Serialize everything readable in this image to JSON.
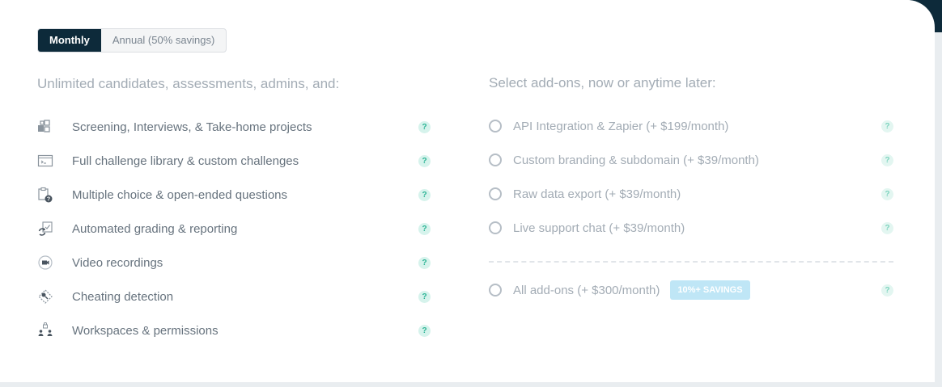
{
  "billing_toggle": {
    "options": [
      "Monthly",
      "Annual (50% savings)"
    ],
    "selected": "Monthly"
  },
  "features": {
    "heading": "Unlimited candidates, assessments, admins, and:",
    "items": [
      {
        "label": "Screening, Interviews, & Take-home projects",
        "icon": "blocks-icon",
        "help": "?"
      },
      {
        "label": "Full challenge library & custom challenges",
        "icon": "terminal-icon",
        "help": "?"
      },
      {
        "label": "Multiple choice & open-ended questions",
        "icon": "clipboard-question-icon",
        "help": "?"
      },
      {
        "label": "Automated grading & reporting",
        "icon": "refresh-check-icon",
        "help": "?"
      },
      {
        "label": "Video recordings",
        "icon": "video-camera-icon",
        "help": "?"
      },
      {
        "label": "Cheating detection",
        "icon": "detection-icon",
        "help": "?"
      },
      {
        "label": "Workspaces & permissions",
        "icon": "users-lock-icon",
        "help": "?"
      }
    ]
  },
  "addons": {
    "heading": "Select add-ons, now or anytime later:",
    "items": [
      {
        "label": "API Integration & Zapier (+ $199/month)",
        "help": "?"
      },
      {
        "label": "Custom branding & subdomain (+ $39/month)",
        "help": "?"
      },
      {
        "label": "Raw data export (+ $39/month)",
        "help": "?"
      },
      {
        "label": "Live support chat (+ $39/month)",
        "help": "?"
      }
    ],
    "bundle": {
      "label": "All add-ons (+ $300/month)",
      "badge": "10%+ SAVINGS",
      "help": "?"
    }
  },
  "colors": {
    "toggle_active_bg": "#0d2a3a",
    "help_bg": "#d6f3ec",
    "help_fg": "#2cb394",
    "badge_bg": "#bfe6f6"
  }
}
